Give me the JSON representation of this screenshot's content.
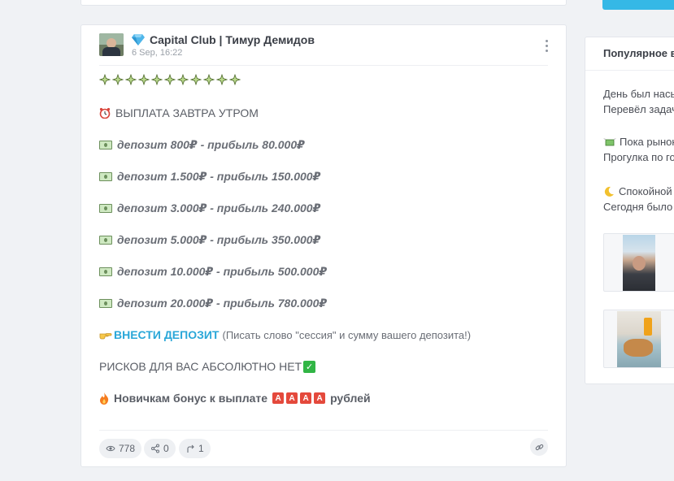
{
  "post": {
    "channel": "Capital Club | Тимур Демидов",
    "timestamp": "6 Sep, 16:22",
    "lines": {
      "payout": "ВЫПЛАТА ЗАВТРА УТРОМ",
      "tiers": [
        "депозит 800₽ - прибыль 80.000₽",
        "депозит 1.500₽ - прибыль 150.000₽",
        "депозит 3.000₽ - прибыль 240.000₽",
        "депозит 5.000₽ - прибыль 350.000₽",
        "депозит 10.000₽ - прибыль 500.000₽",
        "депозит 20.000₽ - прибыль 780.000₽"
      ],
      "deposit_link": "ВНЕСТИ ДЕПОЗИТ",
      "deposit_note": "(Писать слово \"сессия\" и сумму вашего депозита!)",
      "no_risk": "РИСКОВ ДЛЯ ВАС АБСОЛЮТНО НЕТ",
      "bonus_prefix": "Новичкам бонус к выплате",
      "bonus_blocks": [
        "A",
        "A",
        "A",
        "A"
      ],
      "bonus_suffix": "рублей"
    },
    "stats": {
      "views": "778",
      "shares": "0",
      "forwards": "1"
    },
    "icons": [
      "diamond-icon",
      "sparkle-icon",
      "alarm-clock-icon",
      "money-icon",
      "pointing-hand-icon",
      "check-icon",
      "fire-icon",
      "eye-icon",
      "share-icon",
      "forward-icon",
      "link-icon",
      "more-icon"
    ]
  },
  "sidebar": {
    "title": "Популярное в",
    "items": [
      {
        "line1": "День был нась",
        "line2": "Перевёл задач"
      },
      {
        "line1": "Пока рынок",
        "line2": "Прогулка по го"
      },
      {
        "line1": "Спокойной",
        "line2": "Сегодня было"
      }
    ]
  },
  "colors": {
    "link": "#2aa7d8",
    "check": "#31b545",
    "alert_block": "#e4493c",
    "accent_button": "#35b8e6"
  }
}
